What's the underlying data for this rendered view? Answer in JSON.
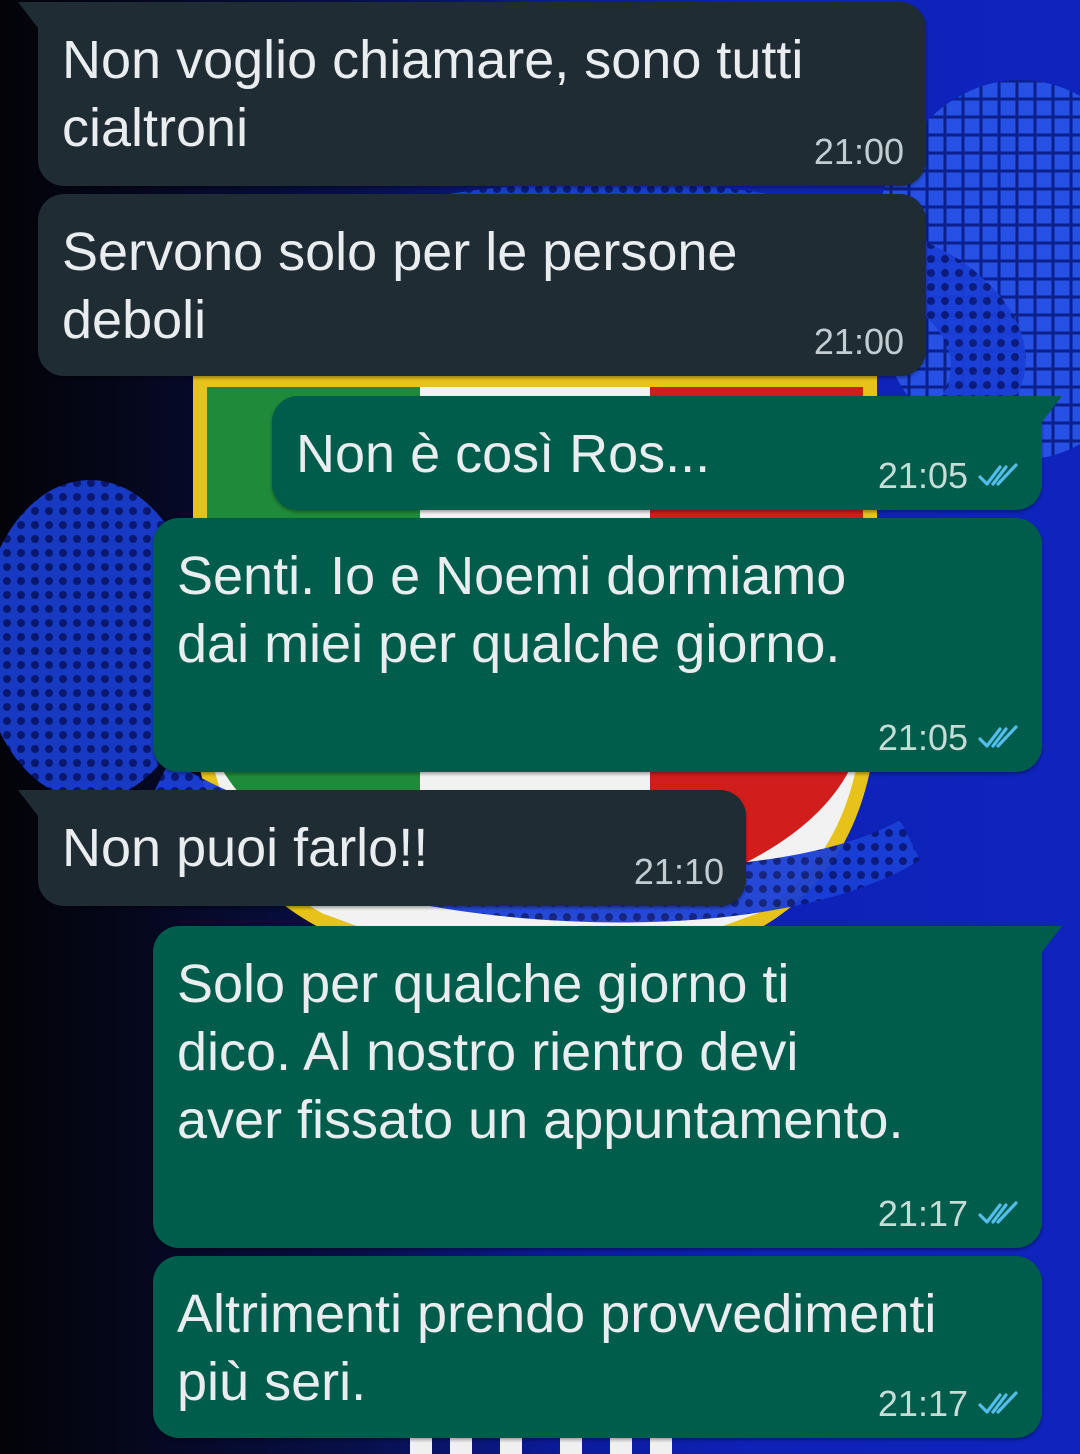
{
  "theme": {
    "incoming_bubble": "#1f2c34",
    "outgoing_bubble": "#005c4b",
    "read_ticks": "#53bdeb",
    "text": "#e9edef"
  },
  "messages": [
    {
      "direction": "incoming",
      "text": "Non voglio chiamare, sono tutti\ncialtroni",
      "time": "21:00"
    },
    {
      "direction": "incoming",
      "text": "Servono solo per le persone\ndeboli",
      "time": "21:00"
    },
    {
      "direction": "outgoing",
      "text": "Non è così Ros...",
      "time": "21:05",
      "status_icon": "double-check-read-icon"
    },
    {
      "direction": "outgoing",
      "text": "Senti. Io e Noemi dormiamo\ndai miei per qualche giorno.",
      "time": "21:05",
      "status_icon": "double-check-read-icon"
    },
    {
      "direction": "incoming",
      "text": "Non puoi farlo!!",
      "time": "21:10"
    },
    {
      "direction": "outgoing",
      "text": "Solo per qualche giorno ti\ndico. Al nostro rientro devi\naver fissato un appuntamento.",
      "time": "21:17",
      "status_icon": "double-check-read-icon"
    },
    {
      "direction": "outgoing",
      "text": "Altrimenti prendo provvedimenti\npiù seri.",
      "time": "21:17",
      "status_icon": "double-check-read-icon"
    }
  ]
}
